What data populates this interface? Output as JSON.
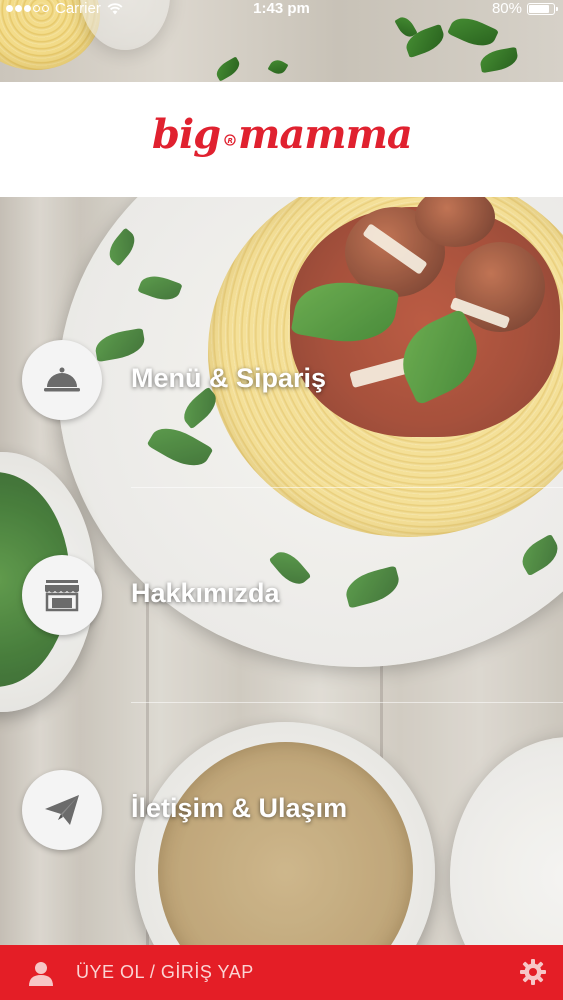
{
  "status_bar": {
    "carrier": "Carrier",
    "time": "1:43 pm",
    "battery": "80%",
    "battery_level": 0.8,
    "signal_dots_filled": 3,
    "signal_dots_total": 5
  },
  "header": {
    "logo_text": "big mamma's"
  },
  "menu": {
    "items": [
      {
        "label": "Menü & Sipariş",
        "icon": "cloche-icon"
      },
      {
        "label": "Hakkımızda",
        "icon": "storefront-icon"
      },
      {
        "label": "İletişim & Ulaşım",
        "icon": "paper-plane-icon"
      }
    ]
  },
  "bottom_bar": {
    "login_label": "ÜYE OL / GİRİŞ YAP",
    "user_icon": "user-icon",
    "settings_icon": "gear-icon"
  },
  "colors": {
    "brand_red": "#e41e26",
    "logo_red": "#e0212f",
    "header_bg": "#ffffff",
    "icon_circle_bg": "#f4f4f4",
    "icon_gray": "#6b6b6b"
  }
}
